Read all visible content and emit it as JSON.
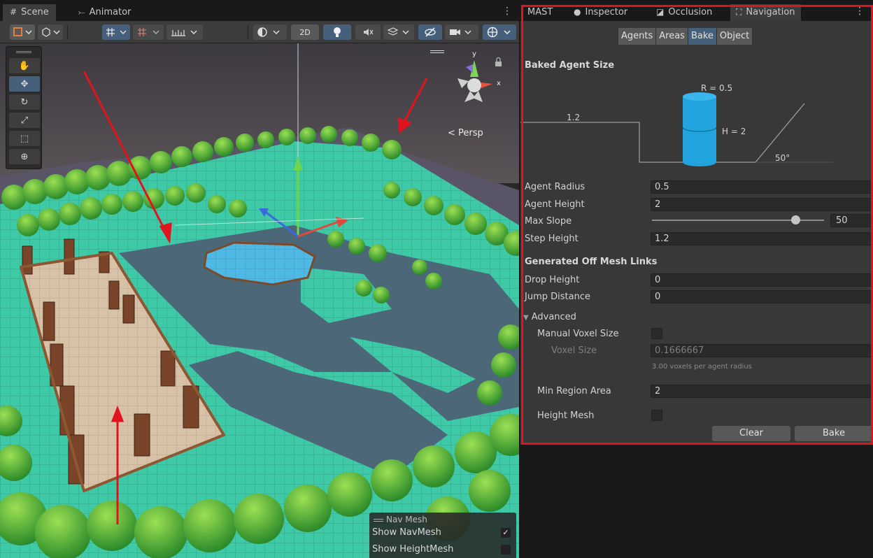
{
  "scene": {
    "tabs": [
      {
        "label": "Scene",
        "glyph": "#"
      },
      {
        "label": "Animator",
        "glyph": "⤚"
      }
    ],
    "toolbar": {
      "toggle_2d": "2D"
    },
    "persp_label": "< Persp",
    "gizmo_axes": {
      "x": "x",
      "y": "y"
    },
    "navmesh_overlay": {
      "title": "Nav Mesh",
      "rows": [
        {
          "label": "Show NavMesh",
          "checked": true,
          "mark": "✓"
        },
        {
          "label": "Show HeightMesh",
          "checked": false,
          "mark": ""
        }
      ]
    }
  },
  "inspector": {
    "tabs": [
      {
        "label": "MAST",
        "glyph": ""
      },
      {
        "label": "Inspector",
        "glyph": "●"
      },
      {
        "label": "Occlusion",
        "glyph": "◪"
      },
      {
        "label": "Navigation",
        "glyph": "⛶"
      }
    ],
    "active_tab": "Navigation",
    "sub_tabs": [
      "Agents",
      "Areas",
      "Bake",
      "Object"
    ],
    "active_sub_tab": "Bake",
    "baked_agent_size": {
      "title": "Baked Agent Size",
      "radius_label": "R = 0.5",
      "height_label": "H = 2",
      "step_label": "1.2",
      "slope_label": "50°"
    },
    "fields": {
      "agent_radius": {
        "label": "Agent Radius",
        "value": "0.5"
      },
      "agent_height": {
        "label": "Agent Height",
        "value": "2"
      },
      "max_slope": {
        "label": "Max Slope",
        "value": "50",
        "fraction": 0.833
      },
      "step_height": {
        "label": "Step Height",
        "value": "1.2"
      }
    },
    "off_mesh": {
      "title": "Generated Off Mesh Links",
      "drop_height": {
        "label": "Drop Height",
        "value": "0"
      },
      "jump_distance": {
        "label": "Jump Distance",
        "value": "0"
      }
    },
    "advanced": {
      "title": "Advanced",
      "manual_voxel_size": {
        "label": "Manual Voxel Size",
        "checked": false
      },
      "voxel_size": {
        "label": "Voxel Size",
        "value": "0.1666667"
      },
      "voxel_hint": "3.00 voxels per agent radius",
      "min_region_area": {
        "label": "Min Region Area",
        "value": "2"
      },
      "height_mesh": {
        "label": "Height Mesh",
        "checked": false
      }
    },
    "buttons": {
      "clear": "Clear",
      "bake": "Bake"
    }
  },
  "colors": {
    "accent_blue": "#46607c",
    "navmesh": "#3ec9a7",
    "annotation_red": "#e0141e",
    "agent_cylinder": "#21a4dd"
  }
}
